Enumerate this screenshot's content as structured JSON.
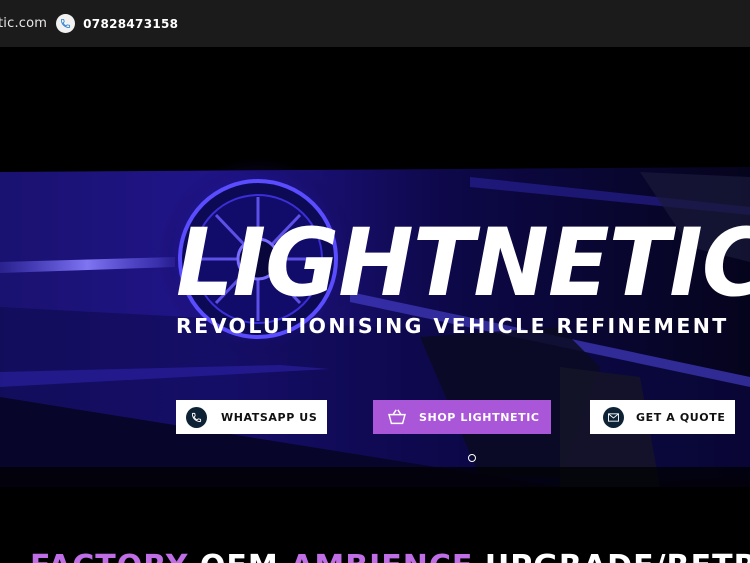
{
  "topbar": {
    "email_fragment": "tic.com",
    "phone": "07828473158",
    "phone_icon": "phone-icon"
  },
  "hero": {
    "brand": "LIGHTNETIC",
    "tagline": "REVOLUTIONISING VEHICLE REFINEMENT",
    "buttons": {
      "whatsapp": "WHATSAPP US",
      "shop": "SHOP LIGHTNETIC",
      "quote": "GET A QUOTE"
    },
    "slider": {
      "active_index": 1,
      "count": 1
    }
  },
  "headline": {
    "word1": "FACTORY",
    "word2": "OEM",
    "word3": "AMBIENCE",
    "word4": "UPGRADE/RETROFIT"
  },
  "colors": {
    "accent_purple": "#a957d8",
    "topbar_bg": "#1b1b1b",
    "icon_navy": "#0e2236"
  }
}
